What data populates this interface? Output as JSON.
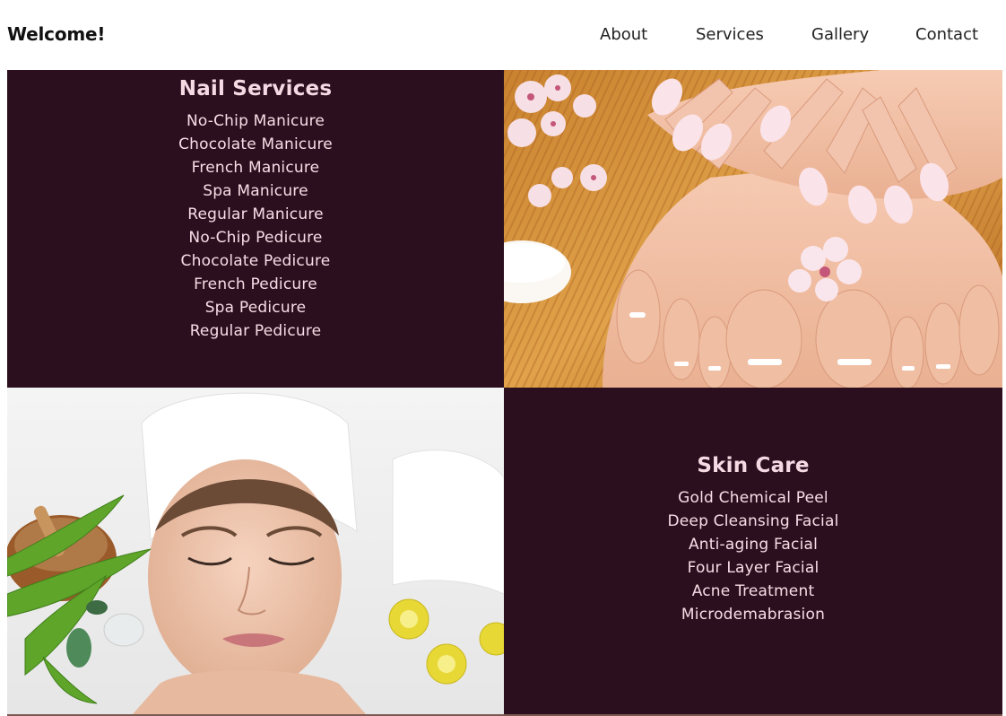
{
  "header": {
    "brand": "Welcome!",
    "nav": [
      {
        "label": "About"
      },
      {
        "label": "Services"
      },
      {
        "label": "Gallery"
      },
      {
        "label": "Contact"
      }
    ]
  },
  "nail_services": {
    "title": "Nail Services",
    "items": [
      "No-Chip Manicure",
      "Chocolate Manicure",
      "French Manicure",
      "Spa Manicure",
      "Regular Manicure",
      "No-Chip Pedicure",
      "Chocolate Pedicure",
      "French Pedicure",
      "Spa Pedicure",
      "Regular Pedicure"
    ]
  },
  "skin_care": {
    "title": "Skin Care",
    "items": [
      "Gold Chemical Peel",
      "Deep Cleansing Facial",
      "Anti-aging Facial",
      "Four Layer Facial",
      "Acne Treatment",
      "Microdemabrasion"
    ]
  },
  "images": {
    "nails_photo": "nails-and-feet-photo",
    "facial_photo": "facial-spa-photo"
  },
  "colors": {
    "panel_background": "#2c0f1e",
    "panel_text": "#f7dde6"
  }
}
